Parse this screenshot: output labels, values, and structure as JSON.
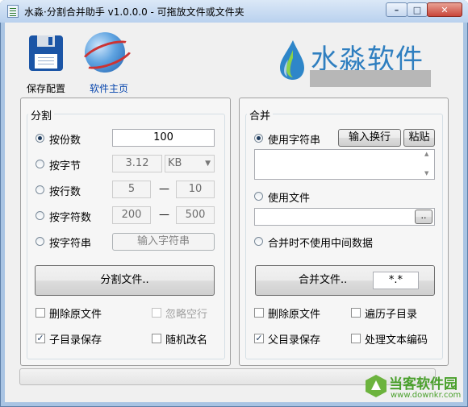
{
  "window": {
    "title": "水淼·分割合并助手 v1.0.0.0 - 可拖放文件或文件夹",
    "controls": {
      "minimize": "–",
      "maximize": "□",
      "close": "✕"
    }
  },
  "toolbar": {
    "save_label": "保存配置",
    "home_label": "软件主页"
  },
  "logo": {
    "text": "水淼软件"
  },
  "split": {
    "title": "分割",
    "by_count_label": "按份数",
    "by_count_value": "100",
    "by_bytes_label": "按字节",
    "by_bytes_value": "3.12",
    "by_bytes_unit": "KB",
    "by_lines_label": "按行数",
    "by_lines_from": "5",
    "by_lines_to": "10",
    "by_chars_label": "按字符数",
    "by_chars_from": "200",
    "by_chars_to": "500",
    "by_string_label": "按字符串",
    "by_string_button": "输入字符串",
    "dash": "—",
    "selected_option": "by_count",
    "split_button": "分割文件..",
    "delete_source": "删除原文件",
    "ignore_blank": "忽略空行",
    "subdir_save": "子目录保存",
    "random_rename": "随机改名",
    "subdir_save_checked": true,
    "delete_source_checked": false,
    "random_rename_checked": false
  },
  "merge": {
    "title": "合并",
    "use_string_label": "使用字符串",
    "input_newline_button": "输入换行",
    "paste_button": "粘贴",
    "use_file_label": "使用文件",
    "browse_button": "..",
    "no_temp_label": "合并时不使用中间数据",
    "selected_option": "use_string",
    "merge_button": "合并文件..",
    "filter_value": "*.*",
    "delete_source": "删除原文件",
    "traverse_subdirs": "遍历子目录",
    "parent_dir_save": "父目录保存",
    "process_encoding": "处理文本编码",
    "parent_dir_save_checked": true
  },
  "progress": {
    "value": 0
  },
  "watermark": {
    "brand": "当客软件园",
    "url": "www.downkr.com"
  },
  "colors": {
    "logo_blue": "#2f7fc0",
    "link": "#0645ad",
    "frame": "#a9c4e3"
  }
}
